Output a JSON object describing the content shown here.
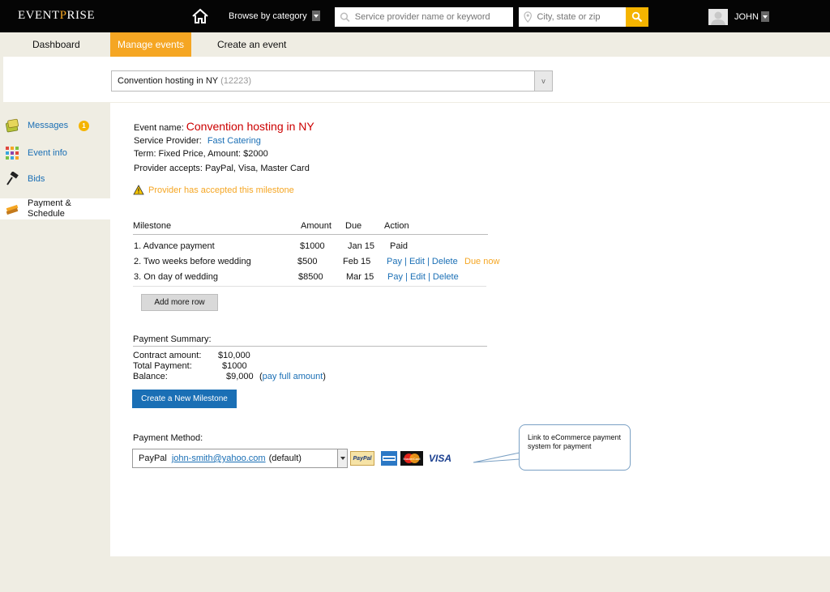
{
  "header": {
    "logo_pre": "EVENT",
    "logo_accent": "P",
    "logo_post": "RISE",
    "browse_label": "Browse by category",
    "search_placeholder": "Service provider name or keyword",
    "location_placeholder": "City, state or zip",
    "user_name": "JOHN"
  },
  "nav": {
    "tabs": [
      {
        "label": "Dashboard"
      },
      {
        "label": "Manage events"
      },
      {
        "label": "Create an event"
      }
    ]
  },
  "event_selector": {
    "value": "Convention hosting in NY",
    "code": "(12223)",
    "caret": "v"
  },
  "sidebar": {
    "items": [
      {
        "label": "Messages",
        "badge": "1"
      },
      {
        "label": "Event info"
      },
      {
        "label": "Bids"
      },
      {
        "label": "Payment & Schedule",
        "label_line1": "Payment &",
        "label_line2": "Schedule"
      }
    ]
  },
  "event": {
    "name_label": "Event name:",
    "name": "Convention hosting in NY",
    "provider_label": "Service Provider:",
    "provider": "Fast Catering",
    "term": "Term: Fixed Price, Amount: $2000",
    "accepts": "Provider accepts: PayPal, Visa, Master Card",
    "warning": "Provider has accepted this milestone"
  },
  "milestones": {
    "headers": {
      "milestone": "Milestone",
      "amount": "Amount",
      "due": "Due",
      "action": "Action"
    },
    "rows": [
      {
        "name": "1. Advance payment",
        "amount": "$1000",
        "due": "Jan 15",
        "status": "Paid"
      },
      {
        "name": "2. Two weeks before wedding",
        "amount": "$500",
        "due": "Feb 15",
        "pay": "Pay",
        "edit": "Edit",
        "delete": "Delete",
        "sep": "|",
        "extra": "Due now"
      },
      {
        "name": "3. On day of wedding",
        "amount": "$8500",
        "due": "Mar 15",
        "pay": "Pay",
        "edit": "Edit",
        "delete": "Delete",
        "sep": "|"
      }
    ],
    "add_row_label": "Add more row"
  },
  "summary": {
    "title": "Payment Summary:",
    "contract_label": "Contract amount:",
    "contract_value": "$10,000",
    "total_label": "Total Payment:",
    "total_value": "$1000",
    "balance_label": "Balance:",
    "balance_value": "$9,000",
    "pay_full_open": "(",
    "pay_full_link": "pay full amount",
    "pay_full_close": ")",
    "create_button": "Create a New Milestone"
  },
  "payment_method": {
    "title": "Payment Method:",
    "provider": "PayPal",
    "email": "john-smith@yahoo.com",
    "default_note": "(default)",
    "paypal_logo": "PayPal",
    "visa_logo": "VISA",
    "mastercard_logo": "MasterCard"
  },
  "callout": {
    "text": "Link to eCommerce payment system for payment"
  },
  "colors": {
    "accent": "#f5a623",
    "link": "#1a6fb5",
    "title_red": "#cc0000",
    "button_blue": "#1a6fb5"
  }
}
